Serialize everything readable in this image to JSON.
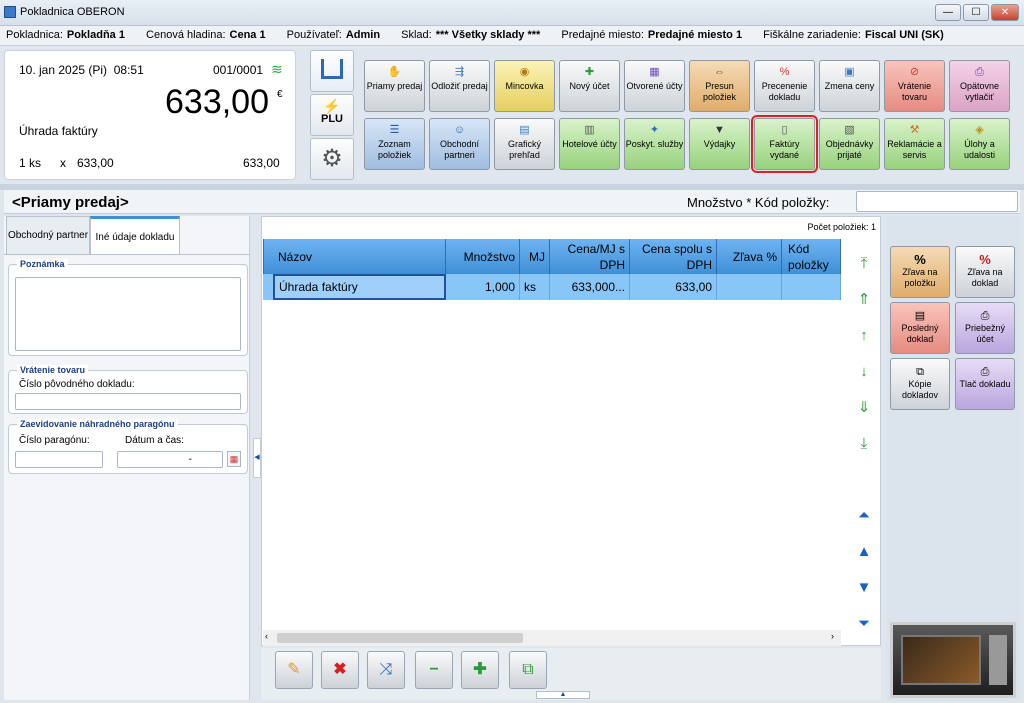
{
  "window": {
    "title": "Pokladnica OBERON",
    "min": "—",
    "max": "☐",
    "close": "✕"
  },
  "info": {
    "pokladnica_label": "Pokladnica:",
    "pokladnica": "Pokladňa 1",
    "cenova_label": "Cenová hladina:",
    "cenova": "Cena 1",
    "pouzivatel_label": "Používateľ:",
    "pouzivatel": "Admin",
    "sklad_label": "Sklad:",
    "sklad": "*** Všetky sklady ***",
    "miesto_label": "Predajné miesto:",
    "miesto": "Predajné miesto 1",
    "fiskal_label": "Fiškálne zariadenie:",
    "fiskal": "Fiscal UNI (SK)"
  },
  "summary": {
    "date": "10. jan 2025 (Pi)",
    "time": "08:51",
    "doc_no": "001/0001",
    "amount": "633,00",
    "currency": "€",
    "item_name": "Úhrada faktúry",
    "qty": "1 ks",
    "x": "x",
    "unit_price": "633,00",
    "line_total": "633,00"
  },
  "nav": {
    "plu": "PLU"
  },
  "toolbar": {
    "row1": [
      {
        "label": "Priamy predaj",
        "icon": "hand-icon"
      },
      {
        "label": "Odložiť predaj",
        "icon": "park-icon"
      },
      {
        "label": "Mincovka",
        "icon": "coins-icon"
      },
      {
        "label": "Nový účet",
        "icon": "new-bill-icon"
      },
      {
        "label": "Otvorené účty",
        "icon": "open-bills-icon"
      },
      {
        "label": "Presun položiek",
        "icon": "move-icon"
      },
      {
        "label": "Precenenie dokladu",
        "icon": "reprice-icon"
      },
      {
        "label": "Zmena ceny",
        "icon": "price-change-icon"
      },
      {
        "label": "Vrátenie tovaru",
        "icon": "return-icon"
      },
      {
        "label": "Opätovne vytlačiť",
        "icon": "reprint-icon"
      }
    ],
    "row2": [
      {
        "label": "Zoznam položiek",
        "icon": "list-icon"
      },
      {
        "label": "Obchodní partneri",
        "icon": "partners-icon"
      },
      {
        "label": "Grafický prehľad",
        "icon": "graph-icon"
      },
      {
        "label": "Hotelové účty",
        "icon": "hotel-icon"
      },
      {
        "label": "Poskyt. služby",
        "icon": "services-icon"
      },
      {
        "label": "Výdajky",
        "icon": "expense-icon"
      },
      {
        "label": "Faktúry vydané",
        "icon": "invoice-icon"
      },
      {
        "label": "Objednávky prijaté",
        "icon": "orders-icon"
      },
      {
        "label": "Reklamácie a servis",
        "icon": "wrench-icon"
      },
      {
        "label": "Úlohy a udalosti",
        "icon": "tasks-icon"
      }
    ]
  },
  "header": {
    "title": "<Priamy predaj>",
    "qty_label": "Množstvo * Kód položky:",
    "qty_value": ""
  },
  "side": {
    "tab1": "Obchodný partner",
    "tab2": "Iné údaje dokladu",
    "note_title": "Poznámka",
    "return_title": "Vrátenie tovaru",
    "orig_doc_label": "Číslo pôvodného dokladu:",
    "paragon_title": "Zaevidovanie náhradného paragónu",
    "paragon_no_label": "Číslo paragónu:",
    "datetime_label": "Dátum a čas:",
    "datetime_value": "-"
  },
  "grid": {
    "count_label": "Počet položiek: 1",
    "columns": [
      "Názov",
      "Množstvo",
      "MJ",
      "Cena/MJ s DPH",
      "Cena spolu s DPH",
      "Zľava %",
      "Kód položky"
    ],
    "row": [
      "Úhrada faktúry",
      "1,000",
      "ks",
      "633,000...",
      "633,00",
      "",
      ""
    ]
  },
  "right": {
    "buttons": [
      {
        "label": "Zľava na položku",
        "icon": "%"
      },
      {
        "label": "Zľava na doklad",
        "icon": "%"
      },
      {
        "label": "Posledný doklad",
        "icon": "last-doc-icon"
      },
      {
        "label": "Priebežný účet",
        "icon": "printer-icon"
      },
      {
        "label": "Kópie dokladov",
        "icon": "copies-icon"
      },
      {
        "label": "Tlač dokladu",
        "icon": "print-icon"
      }
    ]
  }
}
